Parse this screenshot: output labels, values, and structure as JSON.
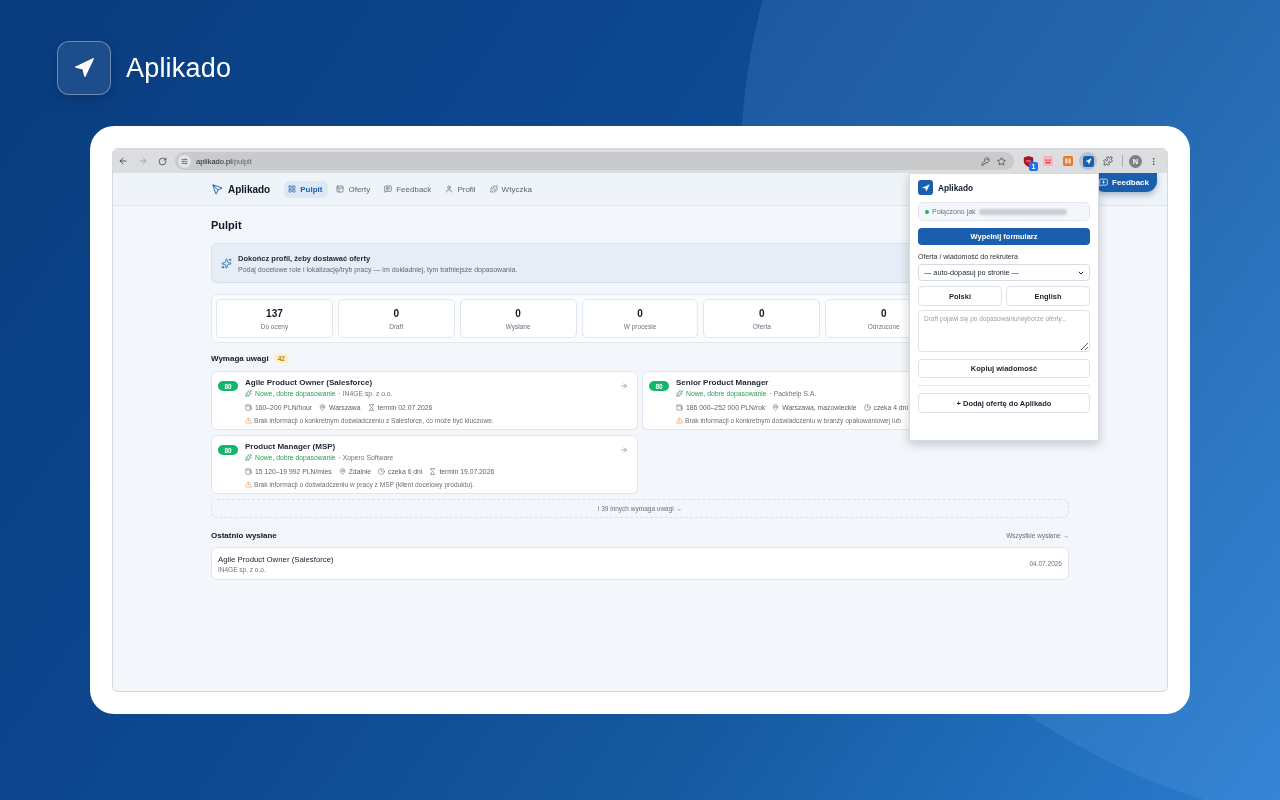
{
  "brand": {
    "name": "Aplikado"
  },
  "browser": {
    "url": {
      "host": "aplikado.pl",
      "path": "/pulpit"
    },
    "extensions": [
      {
        "kind": "shield",
        "badge": "1",
        "selected": false
      },
      {
        "kind": "tile",
        "selected": false
      },
      {
        "kind": "book",
        "selected": false
      },
      {
        "kind": "aplikado",
        "selected": true
      }
    ],
    "profile_initial": "N"
  },
  "app": {
    "brand": "Aplikado",
    "nav": [
      {
        "label": "Pulpit",
        "selected": true
      },
      {
        "label": "Oferty",
        "selected": false
      },
      {
        "label": "Feedback",
        "selected": false
      },
      {
        "label": "Profil",
        "selected": false
      },
      {
        "label": "Wtyczka",
        "selected": false
      }
    ],
    "feedback_button": "Feedback"
  },
  "page": {
    "title": "Pulpit",
    "banner": {
      "title": "Dokończ profil, żeby dostawać oferty",
      "text": "Podaj docelowe role i lokalizację/tryb pracy — im dokładniej, tym trafniejsze dopasowania."
    },
    "stats": [
      {
        "value": "137",
        "label": "Do oceny"
      },
      {
        "value": "0",
        "label": "Draft"
      },
      {
        "value": "0",
        "label": "Wysłane"
      },
      {
        "value": "0",
        "label": "W procesie"
      },
      {
        "value": "0",
        "label": "Oferta"
      },
      {
        "value": "0",
        "label": "Odrzucone"
      }
    ],
    "attention": {
      "title": "Wymaga uwagi",
      "count": "42",
      "cards": [
        {
          "score": "80",
          "title": "Agile Product Owner (Salesforce)",
          "match": "Nowe, dobre dopasowanie",
          "company": "· IN4GE sp. z o.o.",
          "meta": [
            {
              "kind": "salary",
              "text": "160–200 PLN/hour"
            },
            {
              "kind": "location",
              "text": "Warszawa"
            },
            {
              "kind": "deadline",
              "text": "termin 02.07.2026"
            }
          ],
          "warning": "Brak informacji o konkretnym doświadczeniu z Salesforce, co może być kluczowe.",
          "arrow": true
        },
        {
          "score": "80",
          "title": "Senior Product Manager",
          "match": "Nowe, dobre dopasowanie",
          "company": "· Packhelp S.A.",
          "meta": [
            {
              "kind": "salary",
              "text": "186 000–252 000 PLN/rok"
            },
            {
              "kind": "location",
              "text": "Warszawa, mazowieckie"
            },
            {
              "kind": "waiting",
              "text": "czeka 4 dni"
            }
          ],
          "warning": "Brak informacji o konkretnym doświadczeniu w branży opakowaniowej lub"
        },
        {
          "score": "80",
          "title": "Product Manager (MSP)",
          "match": "Nowe, dobre dopasowanie",
          "company": "· Xopero Software",
          "meta": [
            {
              "kind": "salary",
              "text": "15 120–19 992 PLN/mies"
            },
            {
              "kind": "location",
              "text": "Zdalnie"
            },
            {
              "kind": "waiting",
              "text": "czeka 6 dni"
            },
            {
              "kind": "deadline",
              "text": "termin 19.07.2026"
            }
          ],
          "warning": "Brak informacji o doświadczeniu w pracy z MSP (klient docelowy produktu).",
          "arrow": true
        }
      ],
      "more": "i 39 innych wymaga uwagi →"
    },
    "recent": {
      "title": "Ostatnio wysłane",
      "link": "Wszystkie wysłane →",
      "items": [
        {
          "title": "Agile Product Owner (Salesforce)",
          "company": "IN4GE sp. z o.o.",
          "date": "04.07.2026"
        }
      ]
    }
  },
  "popup": {
    "title": "Aplikado",
    "connected": true,
    "status": "Połączono jak",
    "fill_button": "Wypełnij formularz",
    "select_label": "Oferta / wiadomość do rekrutera",
    "select_value": "— auto-dopasuj po stronie —",
    "languages": [
      "Polski",
      "English"
    ],
    "draft_placeholder": "Draft pojawi się po dopasowaniu/wyborze oferty...",
    "copy_button": "Kopiuj wiadomość",
    "add_button": "+ Dodaj ofertę do Aplikado"
  }
}
